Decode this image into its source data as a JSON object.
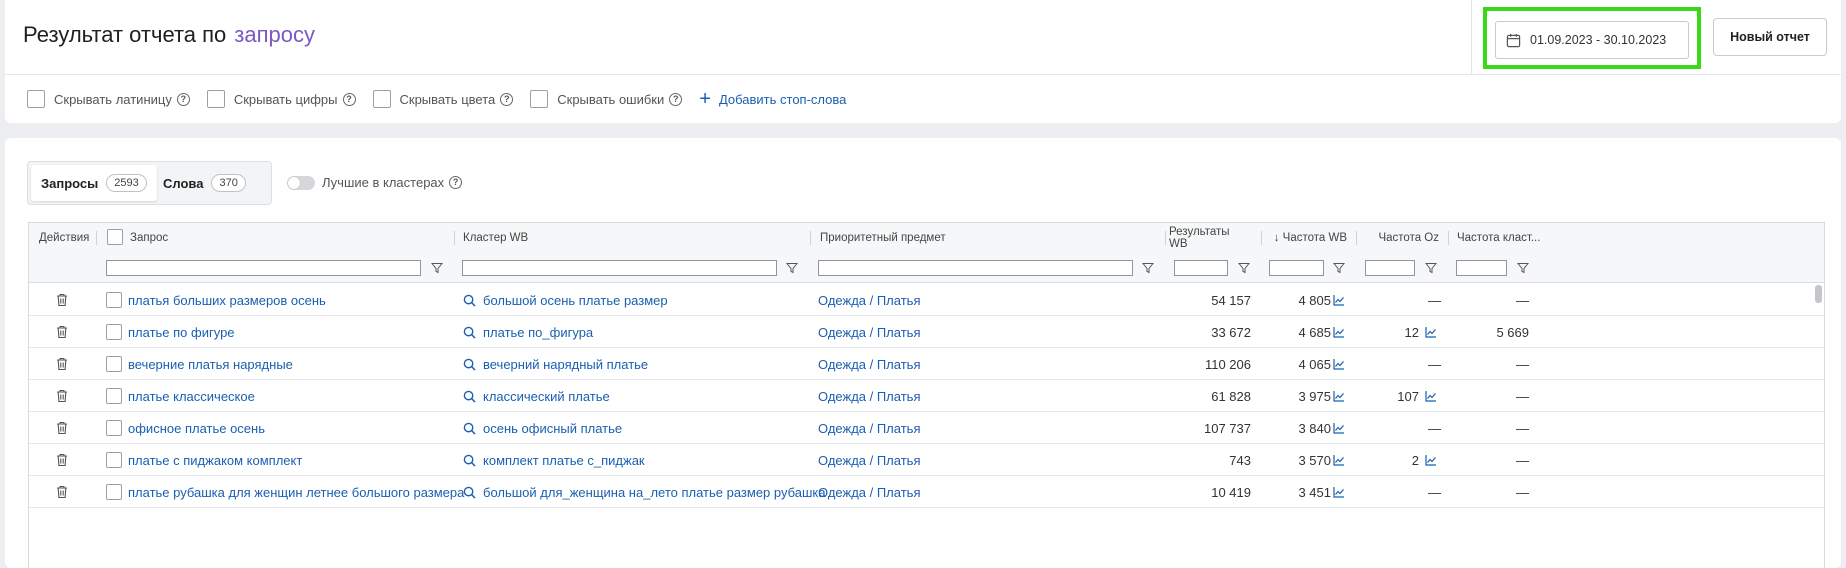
{
  "header": {
    "title_prefix": "Результат отчета по",
    "title_accent": "запросу",
    "date_range": "01.09.2023 - 30.10.2023",
    "new_report_label": "Новый отчет"
  },
  "filters": {
    "items": [
      {
        "label": "Скрывать латиницу"
      },
      {
        "label": "Скрывать цифры"
      },
      {
        "label": "Скрывать цвета"
      },
      {
        "label": "Скрывать ошибки"
      }
    ],
    "add_stop_words": "Добавить стоп-слова"
  },
  "tabs": [
    {
      "label": "Запросы",
      "count": "2593"
    },
    {
      "label": "Слова",
      "count": "370"
    }
  ],
  "toggle_label": "Лучшие в кластерах",
  "table": {
    "columns": {
      "actions": "Действия",
      "query": "Запрос",
      "cluster": "Кластер WB",
      "subject": "Приоритетный предмет",
      "results_wb": "Результаты WB",
      "freq_wb": "↓ Частота WB",
      "freq_oz": "Частота Oz",
      "freq_cluster": "Частота класт..."
    },
    "rows": [
      {
        "query": "платья больших размеров осень",
        "cluster": "большой осень платье размер",
        "subject": "Одежда / Платья",
        "results_wb": "54 157",
        "freq_wb": "4 805",
        "freq_oz": "—",
        "freq_cluster": "—"
      },
      {
        "query": "платье по фигуре",
        "cluster": "платье по_фигура",
        "subject": "Одежда / Платья",
        "results_wb": "33 672",
        "freq_wb": "4 685",
        "freq_oz": "12",
        "freq_cluster": "5 669"
      },
      {
        "query": "вечерние платья нарядные",
        "cluster": "вечерний нарядный платье",
        "subject": "Одежда / Платья",
        "results_wb": "110 206",
        "freq_wb": "4 065",
        "freq_oz": "—",
        "freq_cluster": "—"
      },
      {
        "query": "платье классическое",
        "cluster": "классический платье",
        "subject": "Одежда / Платья",
        "results_wb": "61 828",
        "freq_wb": "3 975",
        "freq_oz": "107",
        "freq_cluster": "—"
      },
      {
        "query": "офисное платье осень",
        "cluster": "осень офисный платье",
        "subject": "Одежда / Платья",
        "results_wb": "107 737",
        "freq_wb": "3 840",
        "freq_oz": "—",
        "freq_cluster": "—"
      },
      {
        "query": "платье с пиджаком комплект",
        "cluster": "комплект платье с_пиджак",
        "subject": "Одежда / Платья",
        "results_wb": "743",
        "freq_wb": "3 570",
        "freq_oz": "2",
        "freq_cluster": "—"
      },
      {
        "query": "платье рубашка для женщин летнее большого размера",
        "cluster": "большой для_женщина на_лето платье размер рубашка",
        "subject": "Одежда / Платья",
        "results_wb": "10 419",
        "freq_wb": "3 451",
        "freq_oz": "—",
        "freq_cluster": "—"
      }
    ]
  },
  "colors": {
    "accent": "#7d57c2",
    "link": "#1b5fb0",
    "highlight": "#39d91a"
  }
}
